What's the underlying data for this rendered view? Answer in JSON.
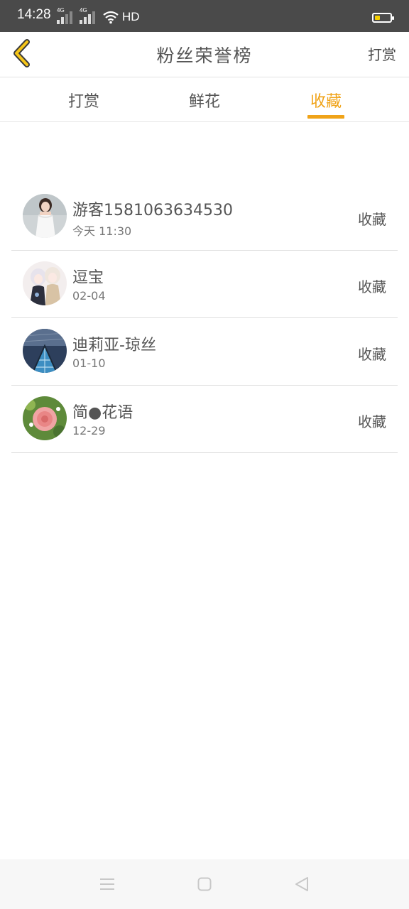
{
  "status_bar": {
    "time": "14:28",
    "network_1": "4G",
    "network_2": "4G",
    "hd": "HD",
    "battery_level": 0.35,
    "battery_color": "#f5d000"
  },
  "header": {
    "title": "粉丝荣誉榜",
    "back_icon": "chevron-left-icon",
    "action_label": "打赏",
    "accent_color": "#f5c518"
  },
  "tabs": [
    {
      "label": "打赏",
      "active": false
    },
    {
      "label": "鲜花",
      "active": false
    },
    {
      "label": "收藏",
      "active": true
    }
  ],
  "accent_color": "#f0a318",
  "list": [
    {
      "name": "游客1581063634530",
      "date": "今天 11:30",
      "action": "收藏",
      "avatar": "avatar-woman-white-dress"
    },
    {
      "name": "逗宝",
      "date": "02-04",
      "action": "收藏",
      "avatar": "avatar-anime-couple"
    },
    {
      "name": "迪莉亚-琼丝",
      "date": "01-10",
      "action": "收藏",
      "avatar": "avatar-glass-building"
    },
    {
      "name": "简●花语",
      "date": "12-29",
      "action": "收藏",
      "avatar": "avatar-pink-flower"
    }
  ],
  "nav_bar": {
    "icons": [
      "menu-icon",
      "home-icon",
      "back-triangle-icon"
    ]
  }
}
